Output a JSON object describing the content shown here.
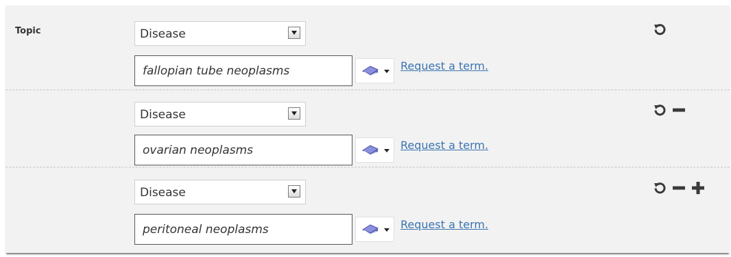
{
  "topic": {
    "label": "Topic"
  },
  "rows": [
    {
      "category": "Disease",
      "term": "fallopian tube neoplasms",
      "request_link": "Request a term.",
      "controls": [
        "reset-icon"
      ]
    },
    {
      "category": "Disease",
      "term": "ovarian neoplasms",
      "request_link": "Request a term.",
      "controls": [
        "reset-icon",
        "minus-icon"
      ]
    },
    {
      "category": "Disease",
      "term": "peritoneal neoplasms",
      "request_link": "Request a term.",
      "controls": [
        "reset-icon",
        "minus-icon",
        "plus-icon"
      ]
    }
  ],
  "colors": {
    "panel_bg": "#f2f2f2",
    "link": "#3a73b0",
    "icon": "#3a3a3a",
    "vocab_book": "#6a72c8"
  }
}
